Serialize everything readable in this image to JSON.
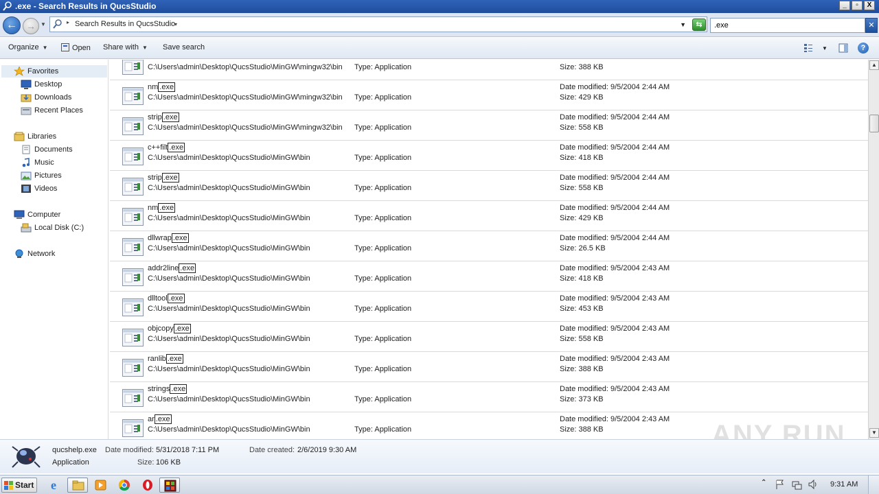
{
  "window": {
    "title": ".exe - Search Results in QucsStudio",
    "buttons": {
      "minimize": "_",
      "maximize": "▫",
      "close": "X"
    }
  },
  "address": {
    "breadcrumb": "Search Results in QucsStudio",
    "search_value": ".exe"
  },
  "toolbar": {
    "organize": "Organize",
    "open": "Open",
    "share_with": "Share with",
    "save_search": "Save search"
  },
  "nav": {
    "favorites": "Favorites",
    "desktop": "Desktop",
    "downloads": "Downloads",
    "recent_places": "Recent Places",
    "libraries": "Libraries",
    "documents": "Documents",
    "music": "Music",
    "pictures": "Pictures",
    "videos": "Videos",
    "computer": "Computer",
    "local_disk": "Local Disk (C:)",
    "network": "Network"
  },
  "results": [
    {
      "name": "",
      "ext": "",
      "path": "C:\\Users\\admin\\Desktop\\QucsStudio\\MinGW\\mingw32\\bin",
      "type": "Type: Application",
      "date": "",
      "size": "Size: 388 KB"
    },
    {
      "name": "nm",
      "ext": "exe",
      "path": "C:\\Users\\admin\\Desktop\\QucsStudio\\MinGW\\mingw32\\bin",
      "type": "Type: Application",
      "date": "Date modified: 9/5/2004 2:44 AM",
      "size": "Size: 429 KB"
    },
    {
      "name": "strip",
      "ext": "exe",
      "path": "C:\\Users\\admin\\Desktop\\QucsStudio\\MinGW\\mingw32\\bin",
      "type": "Type: Application",
      "date": "Date modified: 9/5/2004 2:44 AM",
      "size": "Size: 558 KB"
    },
    {
      "name": "c++filt",
      "ext": "exe",
      "path": "C:\\Users\\admin\\Desktop\\QucsStudio\\MinGW\\bin",
      "type": "Type: Application",
      "date": "Date modified: 9/5/2004 2:44 AM",
      "size": "Size: 418 KB"
    },
    {
      "name": "strip",
      "ext": "exe",
      "path": "C:\\Users\\admin\\Desktop\\QucsStudio\\MinGW\\bin",
      "type": "Type: Application",
      "date": "Date modified: 9/5/2004 2:44 AM",
      "size": "Size: 558 KB"
    },
    {
      "name": "nm",
      "ext": "exe",
      "path": "C:\\Users\\admin\\Desktop\\QucsStudio\\MinGW\\bin",
      "type": "Type: Application",
      "date": "Date modified: 9/5/2004 2:44 AM",
      "size": "Size: 429 KB"
    },
    {
      "name": "dllwrap",
      "ext": "exe",
      "path": "C:\\Users\\admin\\Desktop\\QucsStudio\\MinGW\\bin",
      "type": "Type: Application",
      "date": "Date modified: 9/5/2004 2:44 AM",
      "size": "Size: 26.5 KB"
    },
    {
      "name": "addr2line",
      "ext": "exe",
      "path": "C:\\Users\\admin\\Desktop\\QucsStudio\\MinGW\\bin",
      "type": "Type: Application",
      "date": "Date modified: 9/5/2004 2:43 AM",
      "size": "Size: 418 KB"
    },
    {
      "name": "dlltool",
      "ext": "exe",
      "path": "C:\\Users\\admin\\Desktop\\QucsStudio\\MinGW\\bin",
      "type": "Type: Application",
      "date": "Date modified: 9/5/2004 2:43 AM",
      "size": "Size: 453 KB"
    },
    {
      "name": "objcopy",
      "ext": "exe",
      "path": "C:\\Users\\admin\\Desktop\\QucsStudio\\MinGW\\bin",
      "type": "Type: Application",
      "date": "Date modified: 9/5/2004 2:43 AM",
      "size": "Size: 558 KB"
    },
    {
      "name": "ranlib",
      "ext": "exe",
      "path": "C:\\Users\\admin\\Desktop\\QucsStudio\\MinGW\\bin",
      "type": "Type: Application",
      "date": "Date modified: 9/5/2004 2:43 AM",
      "size": "Size: 388 KB"
    },
    {
      "name": "strings",
      "ext": "exe",
      "path": "C:\\Users\\admin\\Desktop\\QucsStudio\\MinGW\\bin",
      "type": "Type: Application",
      "date": "Date modified: 9/5/2004 2:43 AM",
      "size": "Size: 373 KB"
    },
    {
      "name": "ar",
      "ext": "exe",
      "path": "C:\\Users\\admin\\Desktop\\QucsStudio\\MinGW\\bin",
      "type": "Type: Application",
      "date": "Date modified: 9/5/2004 2:43 AM",
      "size": "Size: 388 KB"
    }
  ],
  "details": {
    "filename": "qucshelp.exe",
    "date_modified_label": "Date modified:",
    "date_modified": "5/31/2018 7:11 PM",
    "date_created_label": "Date created:",
    "date_created": "2/6/2019 9:30 AM",
    "type": "Application",
    "size_label": "Size:",
    "size": "106 KB"
  },
  "watermark": "ANY RUN",
  "taskbar": {
    "start": "Start",
    "clock": "9:31 AM"
  },
  "icons": {
    "back": "back-arrow-icon",
    "forward": "forward-arrow-icon",
    "file": "application-file-icon"
  },
  "colors": {
    "titlebar": "#2f63b9",
    "nav_selected": "#e4ecf6",
    "row_divider": "#d9d9d9"
  }
}
